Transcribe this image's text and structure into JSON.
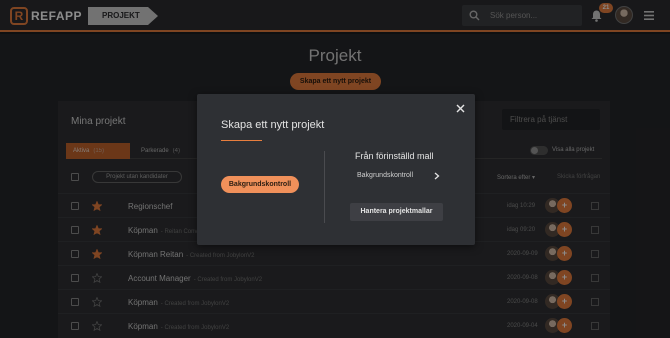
{
  "header": {
    "logo_text": "REFAPP",
    "breadcrumb": "PROJEKT",
    "search_placeholder": "Sök person...",
    "notification_count": "21"
  },
  "page": {
    "title": "Projekt",
    "new_project_button": "Skapa ett nytt projekt"
  },
  "panel": {
    "title": "Mina projekt",
    "filter_placeholder": "Filtrera på tjänst",
    "tabs": [
      {
        "label": "Aktiva",
        "count": "(15)"
      },
      {
        "label": "Parkerade",
        "count": "(4)"
      }
    ],
    "show_all_label": "Visa alla projekt",
    "no_candidates_pill": "Projekt utan kandidater",
    "sort_label": "Sortera efter",
    "send_label": "Skicka förfrågan",
    "rows": [
      {
        "name": "Regionschef",
        "sub": "",
        "date": "idag 10:29",
        "starred": true
      },
      {
        "name": "Köpman",
        "sub": "- Reitan Convenience",
        "date": "idag 09:20",
        "starred": true
      },
      {
        "name": "Köpman Reitan",
        "sub": "- Created from JobylonV2",
        "date": "2020-09-09",
        "starred": true
      },
      {
        "name": "Account Manager",
        "sub": "- Created from JobylonV2",
        "date": "2020-09-08",
        "starred": false
      },
      {
        "name": "Köpman",
        "sub": "- Created from JobylonV2",
        "date": "2020-09-08",
        "starred": false
      },
      {
        "name": "Köpman",
        "sub": "- Created from JobylonV2",
        "date": "2020-09-04",
        "starred": false
      }
    ]
  },
  "modal": {
    "title": "Skapa ett nytt projekt",
    "basic_button": "Bakgrundskontroll",
    "template_heading": "Från förinställd mall",
    "template_item": "Bakgrundskontroll",
    "manage_button": "Hantera projektmallar"
  },
  "colors": {
    "accent": "#e87e3e",
    "background": "#1b1c1e",
    "modal_bg": "#2e3034"
  },
  "icons": [
    "search-icon",
    "bell-icon",
    "menu-icon",
    "close-icon",
    "chevron-right-icon",
    "star-icon"
  ]
}
